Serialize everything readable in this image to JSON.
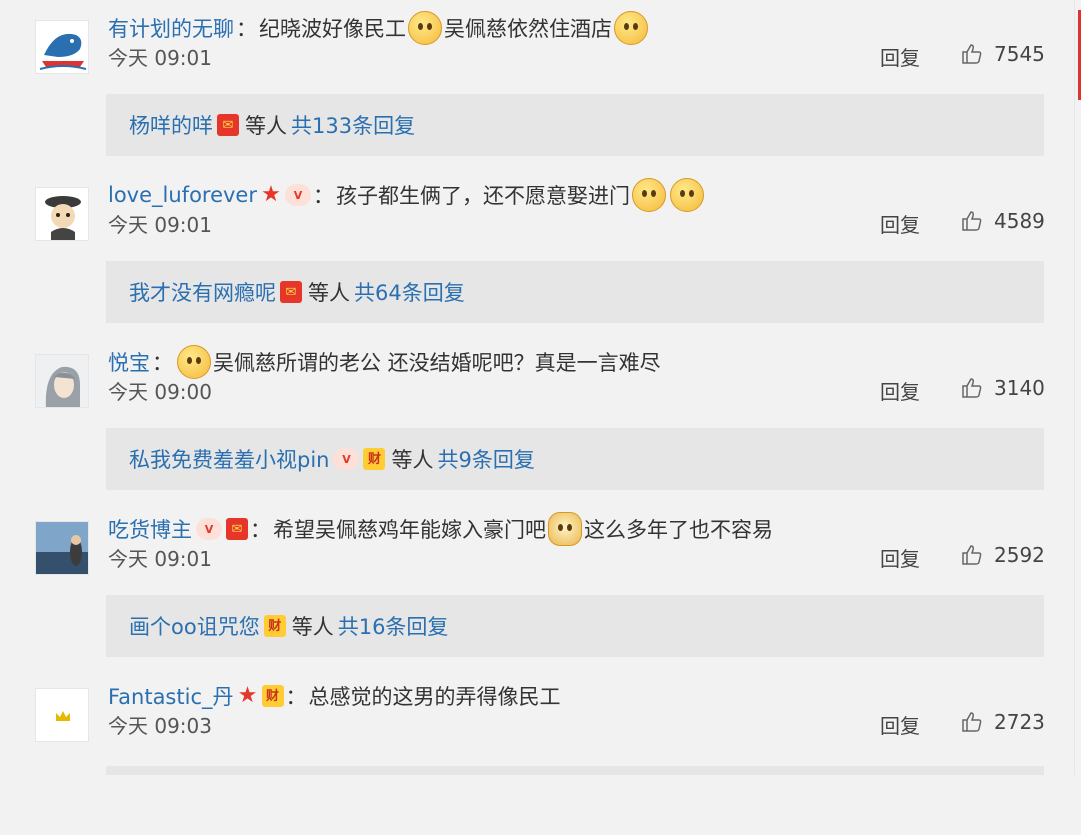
{
  "comments": [
    {
      "username": "有计划的无聊",
      "colon": "：",
      "text1": "纪晓波好像民工",
      "text2": "吴佩慈依然住酒店",
      "time": "今天 09:01",
      "reply_label": "回复",
      "likes": "7545",
      "sub": {
        "user": "杨咩的咩",
        "etc": "等人",
        "count_text": "共133条回复"
      }
    },
    {
      "username": "love_luforever",
      "colon": "：",
      "text1": "孩子都生俩了，还不愿意娶进门",
      "text2": "",
      "time": "今天 09:01",
      "reply_label": "回复",
      "likes": "4589",
      "sub": {
        "user": "我才没有网瘾呢",
        "etc": "等人",
        "count_text": "共64条回复"
      }
    },
    {
      "username": "悦宝",
      "colon": "：",
      "text1": "吴佩慈所谓的老公 还没结婚呢吧？真是一言难尽",
      "text2": "",
      "time": "今天 09:00",
      "reply_label": "回复",
      "likes": "3140",
      "sub": {
        "user": "私我免费羞羞小视pin",
        "etc": "等人",
        "count_text": "共9条回复"
      }
    },
    {
      "username": "吃货博主",
      "colon": "：",
      "text1": "希望吴佩慈鸡年能嫁入豪门吧",
      "text2": "这么多年了也不容易",
      "time": "今天 09:01",
      "reply_label": "回复",
      "likes": "2592",
      "sub": {
        "user": "画个oo诅咒您",
        "etc": "等人",
        "count_text": "共16条回复"
      }
    },
    {
      "username": "Fantastic_丹",
      "colon": "：",
      "text1": "总感觉的这男的弄得像民工",
      "text2": "",
      "time": "今天 09:03",
      "reply_label": "回复",
      "likes": "2723"
    }
  ],
  "badges": {
    "hongbao": "红包",
    "cai": "财",
    "star": "★",
    "vip": "V"
  },
  "colors": {
    "link": "#2a6fb0",
    "background": "#f2f2f2",
    "sub_background": "#e6e6e6",
    "hongbao": "#e6362a",
    "cai": "#ffcc33"
  },
  "icons": {
    "like": "thumbs-up-icon",
    "emoticon": "emoticon-icon"
  }
}
